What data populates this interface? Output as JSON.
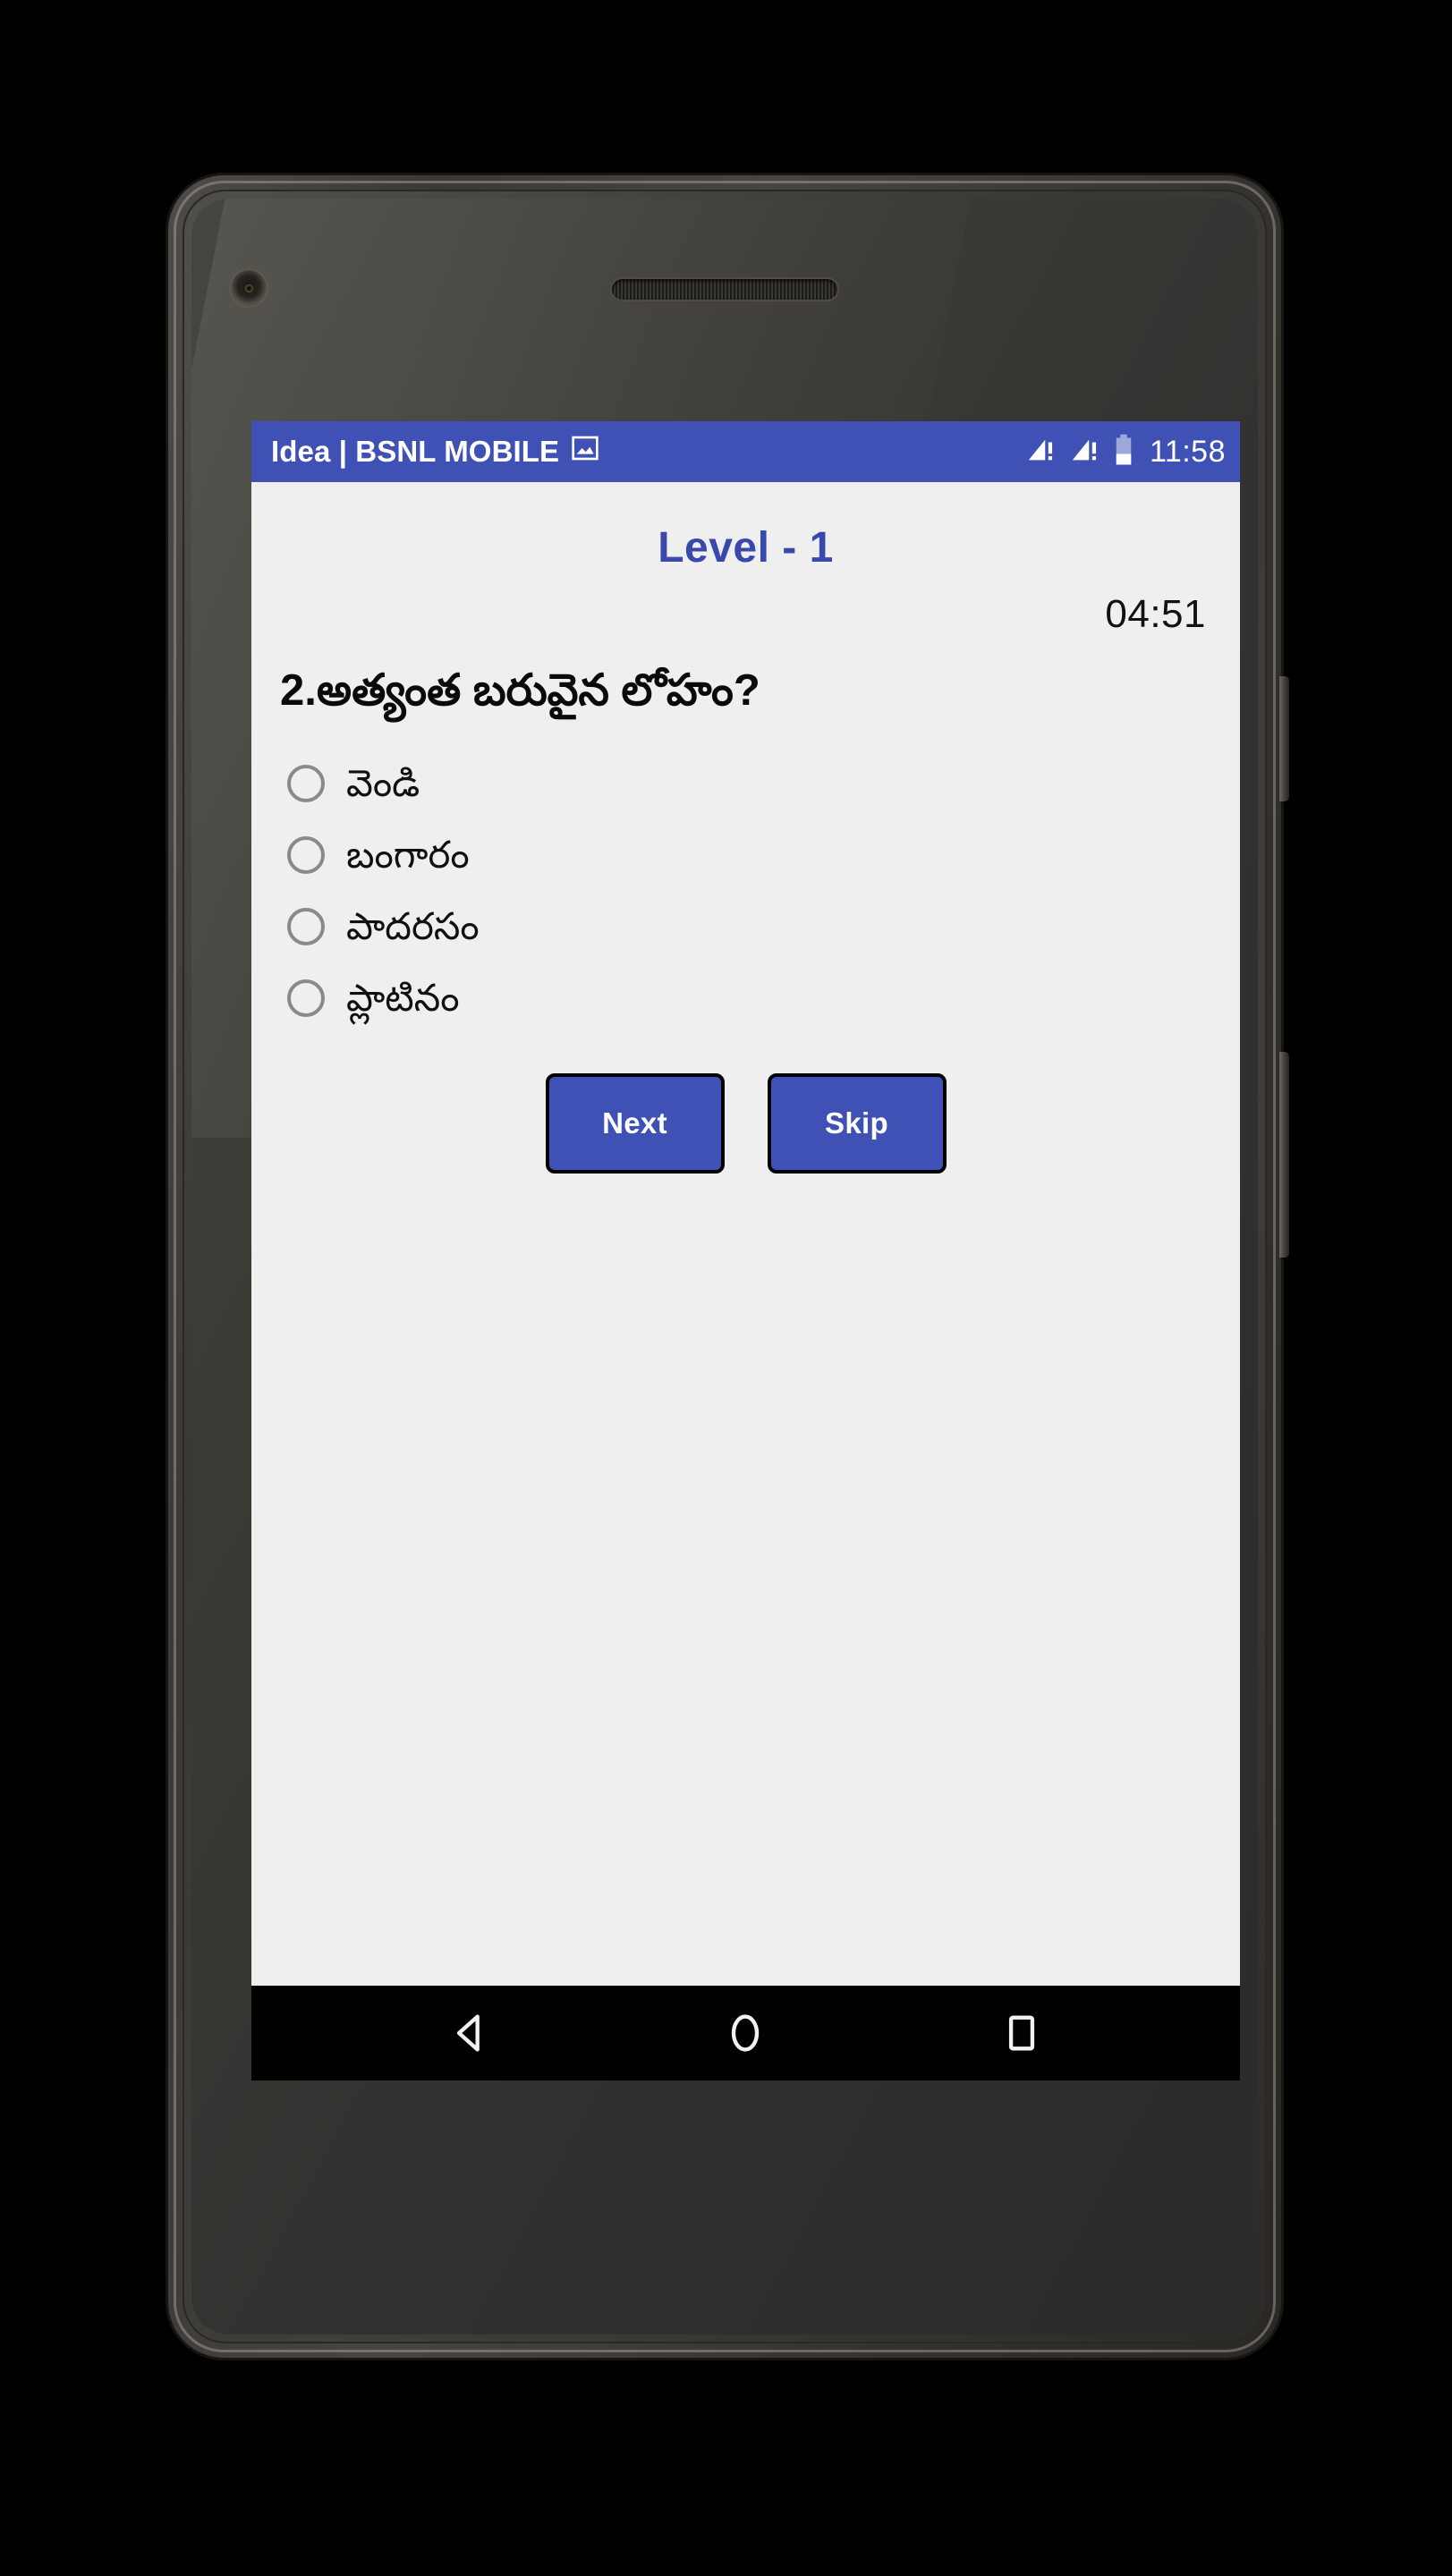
{
  "device": {
    "type": "android-smartphone",
    "bezel_color": "#3b3936",
    "hardware": {
      "front_camera": "front-camera",
      "earpiece": "earpiece-speaker",
      "proximity_sensor": "proximity-sensor",
      "power_button": "power-button",
      "volume_button": "volume-button"
    }
  },
  "status_bar": {
    "carrier": "Idea | BSNL MOBILE",
    "carrier_icon": "image-notification-icon",
    "signal_icons": [
      "signal-bars-warning-icon",
      "signal-bars-warning-icon"
    ],
    "battery_icon": "battery-half-icon",
    "clock": "11:58",
    "background_color": "#3f51b5",
    "text_color": "#ffffff"
  },
  "app": {
    "background_color": "#efeff0",
    "accent_color": "#3f51b5",
    "title_color": "#3949ab",
    "level_title": "Level - 1",
    "timer": "04:51",
    "question": {
      "number": "2.",
      "text": "2.అత్యంత బరువైన లోహం?"
    },
    "options": [
      {
        "label": "వెండి",
        "selected": false
      },
      {
        "label": "బంగారం",
        "selected": false
      },
      {
        "label": "పాదరసం",
        "selected": false
      },
      {
        "label": "ప్లాటినం",
        "selected": false
      }
    ],
    "buttons": {
      "next": "Next",
      "skip": "Skip"
    }
  },
  "nav_bar": {
    "background_color": "#000000",
    "buttons": [
      {
        "name": "back-icon",
        "label": "Back"
      },
      {
        "name": "home-icon",
        "label": "Home"
      },
      {
        "name": "recents-icon",
        "label": "Recent apps"
      }
    ]
  }
}
